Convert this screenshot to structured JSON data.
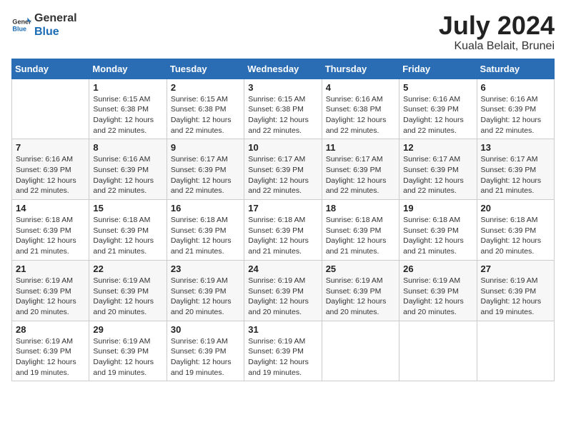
{
  "logo": {
    "line1": "General",
    "line2": "Blue"
  },
  "title": "July 2024",
  "location": "Kuala Belait, Brunei",
  "days_of_week": [
    "Sunday",
    "Monday",
    "Tuesday",
    "Wednesday",
    "Thursday",
    "Friday",
    "Saturday"
  ],
  "weeks": [
    [
      {
        "day": "",
        "info": ""
      },
      {
        "day": "1",
        "info": "Sunrise: 6:15 AM\nSunset: 6:38 PM\nDaylight: 12 hours\nand 22 minutes."
      },
      {
        "day": "2",
        "info": "Sunrise: 6:15 AM\nSunset: 6:38 PM\nDaylight: 12 hours\nand 22 minutes."
      },
      {
        "day": "3",
        "info": "Sunrise: 6:15 AM\nSunset: 6:38 PM\nDaylight: 12 hours\nand 22 minutes."
      },
      {
        "day": "4",
        "info": "Sunrise: 6:16 AM\nSunset: 6:38 PM\nDaylight: 12 hours\nand 22 minutes."
      },
      {
        "day": "5",
        "info": "Sunrise: 6:16 AM\nSunset: 6:39 PM\nDaylight: 12 hours\nand 22 minutes."
      },
      {
        "day": "6",
        "info": "Sunrise: 6:16 AM\nSunset: 6:39 PM\nDaylight: 12 hours\nand 22 minutes."
      }
    ],
    [
      {
        "day": "7",
        "info": "Sunrise: 6:16 AM\nSunset: 6:39 PM\nDaylight: 12 hours\nand 22 minutes."
      },
      {
        "day": "8",
        "info": "Sunrise: 6:16 AM\nSunset: 6:39 PM\nDaylight: 12 hours\nand 22 minutes."
      },
      {
        "day": "9",
        "info": "Sunrise: 6:17 AM\nSunset: 6:39 PM\nDaylight: 12 hours\nand 22 minutes."
      },
      {
        "day": "10",
        "info": "Sunrise: 6:17 AM\nSunset: 6:39 PM\nDaylight: 12 hours\nand 22 minutes."
      },
      {
        "day": "11",
        "info": "Sunrise: 6:17 AM\nSunset: 6:39 PM\nDaylight: 12 hours\nand 22 minutes."
      },
      {
        "day": "12",
        "info": "Sunrise: 6:17 AM\nSunset: 6:39 PM\nDaylight: 12 hours\nand 22 minutes."
      },
      {
        "day": "13",
        "info": "Sunrise: 6:17 AM\nSunset: 6:39 PM\nDaylight: 12 hours\nand 21 minutes."
      }
    ],
    [
      {
        "day": "14",
        "info": "Sunrise: 6:18 AM\nSunset: 6:39 PM\nDaylight: 12 hours\nand 21 minutes."
      },
      {
        "day": "15",
        "info": "Sunrise: 6:18 AM\nSunset: 6:39 PM\nDaylight: 12 hours\nand 21 minutes."
      },
      {
        "day": "16",
        "info": "Sunrise: 6:18 AM\nSunset: 6:39 PM\nDaylight: 12 hours\nand 21 minutes."
      },
      {
        "day": "17",
        "info": "Sunrise: 6:18 AM\nSunset: 6:39 PM\nDaylight: 12 hours\nand 21 minutes."
      },
      {
        "day": "18",
        "info": "Sunrise: 6:18 AM\nSunset: 6:39 PM\nDaylight: 12 hours\nand 21 minutes."
      },
      {
        "day": "19",
        "info": "Sunrise: 6:18 AM\nSunset: 6:39 PM\nDaylight: 12 hours\nand 21 minutes."
      },
      {
        "day": "20",
        "info": "Sunrise: 6:18 AM\nSunset: 6:39 PM\nDaylight: 12 hours\nand 20 minutes."
      }
    ],
    [
      {
        "day": "21",
        "info": "Sunrise: 6:19 AM\nSunset: 6:39 PM\nDaylight: 12 hours\nand 20 minutes."
      },
      {
        "day": "22",
        "info": "Sunrise: 6:19 AM\nSunset: 6:39 PM\nDaylight: 12 hours\nand 20 minutes."
      },
      {
        "day": "23",
        "info": "Sunrise: 6:19 AM\nSunset: 6:39 PM\nDaylight: 12 hours\nand 20 minutes."
      },
      {
        "day": "24",
        "info": "Sunrise: 6:19 AM\nSunset: 6:39 PM\nDaylight: 12 hours\nand 20 minutes."
      },
      {
        "day": "25",
        "info": "Sunrise: 6:19 AM\nSunset: 6:39 PM\nDaylight: 12 hours\nand 20 minutes."
      },
      {
        "day": "26",
        "info": "Sunrise: 6:19 AM\nSunset: 6:39 PM\nDaylight: 12 hours\nand 20 minutes."
      },
      {
        "day": "27",
        "info": "Sunrise: 6:19 AM\nSunset: 6:39 PM\nDaylight: 12 hours\nand 19 minutes."
      }
    ],
    [
      {
        "day": "28",
        "info": "Sunrise: 6:19 AM\nSunset: 6:39 PM\nDaylight: 12 hours\nand 19 minutes."
      },
      {
        "day": "29",
        "info": "Sunrise: 6:19 AM\nSunset: 6:39 PM\nDaylight: 12 hours\nand 19 minutes."
      },
      {
        "day": "30",
        "info": "Sunrise: 6:19 AM\nSunset: 6:39 PM\nDaylight: 12 hours\nand 19 minutes."
      },
      {
        "day": "31",
        "info": "Sunrise: 6:19 AM\nSunset: 6:39 PM\nDaylight: 12 hours\nand 19 minutes."
      },
      {
        "day": "",
        "info": ""
      },
      {
        "day": "",
        "info": ""
      },
      {
        "day": "",
        "info": ""
      }
    ]
  ]
}
